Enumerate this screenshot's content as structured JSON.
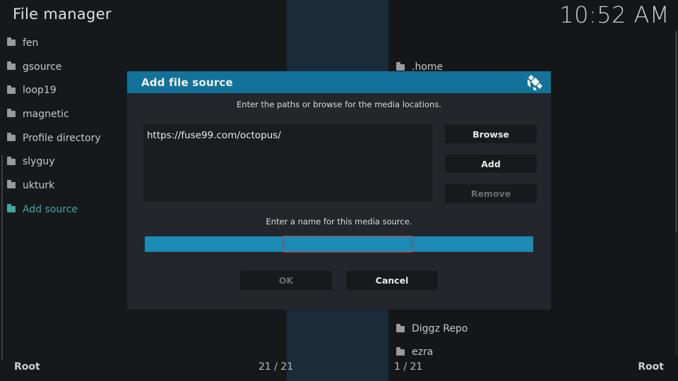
{
  "header": {
    "title": "File manager",
    "clock": "10:52 AM"
  },
  "left_pane": {
    "items": [
      {
        "label": "fen"
      },
      {
        "label": "gsource"
      },
      {
        "label": "loop19"
      },
      {
        "label": "magnetic"
      },
      {
        "label": "Profile directory"
      },
      {
        "label": "slyguy"
      },
      {
        "label": "ukturk"
      },
      {
        "label": "Add source",
        "active": true
      }
    ],
    "footer_label": "Root",
    "count": "21 / 21"
  },
  "right_pane": {
    "items": [
      {
        "label": ".home"
      },
      {
        "label": "Diggz Repo"
      },
      {
        "label": "ezra"
      }
    ],
    "footer_label": "Root",
    "count": "1 / 21"
  },
  "dialog": {
    "title": "Add file source",
    "instructions": "Enter the paths or browse for the media locations.",
    "paths": [
      "https://fuse99.com/octopus/"
    ],
    "buttons": {
      "browse": "Browse",
      "add": "Add",
      "remove": "Remove"
    },
    "name_label": "Enter a name for this media source.",
    "name_value": "",
    "ok": "OK",
    "cancel": "Cancel"
  },
  "colors": {
    "accent": "#12729a",
    "active_text": "#3fa6a6",
    "name_field": "#1b8ab5",
    "cursor_outline": "#d02a2a"
  },
  "icons": [
    "folder-icon",
    "kodi-logo-icon"
  ]
}
